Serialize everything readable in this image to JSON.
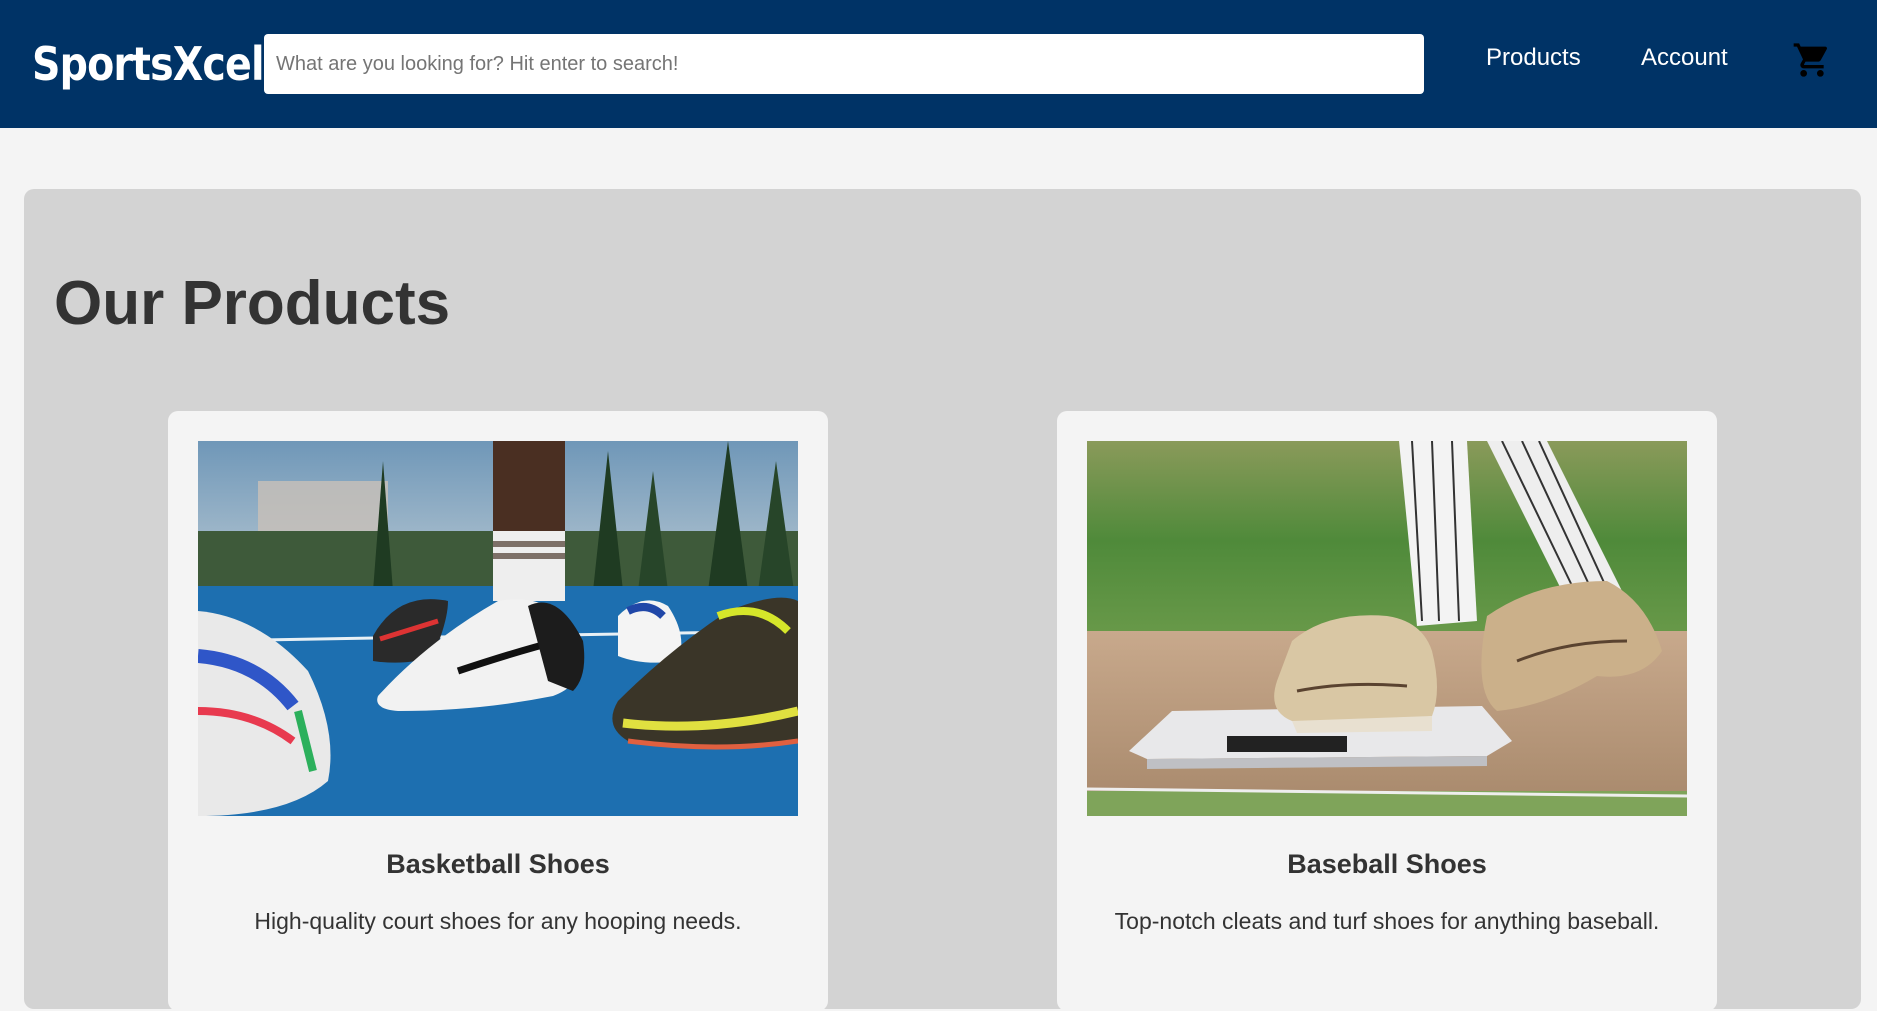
{
  "header": {
    "logo": "SportsXcel",
    "search_placeholder": "What are you looking for? Hit enter to search!",
    "search_value": "",
    "nav": [
      {
        "label": "Products"
      },
      {
        "label": "Account"
      }
    ],
    "cart_icon": "cart-icon"
  },
  "main": {
    "title": "Our Products",
    "products": [
      {
        "name": "Basketball Shoes",
        "description": "High-quality court shoes for any hooping needs."
      },
      {
        "name": "Baseball Shoes",
        "description": "Top-notch cleats and turf shoes for anything baseball."
      }
    ]
  },
  "colors": {
    "header_bg": "#003366",
    "page_bg": "#f4f4f4",
    "panel_bg": "#d3d3d3",
    "text": "#333333"
  }
}
